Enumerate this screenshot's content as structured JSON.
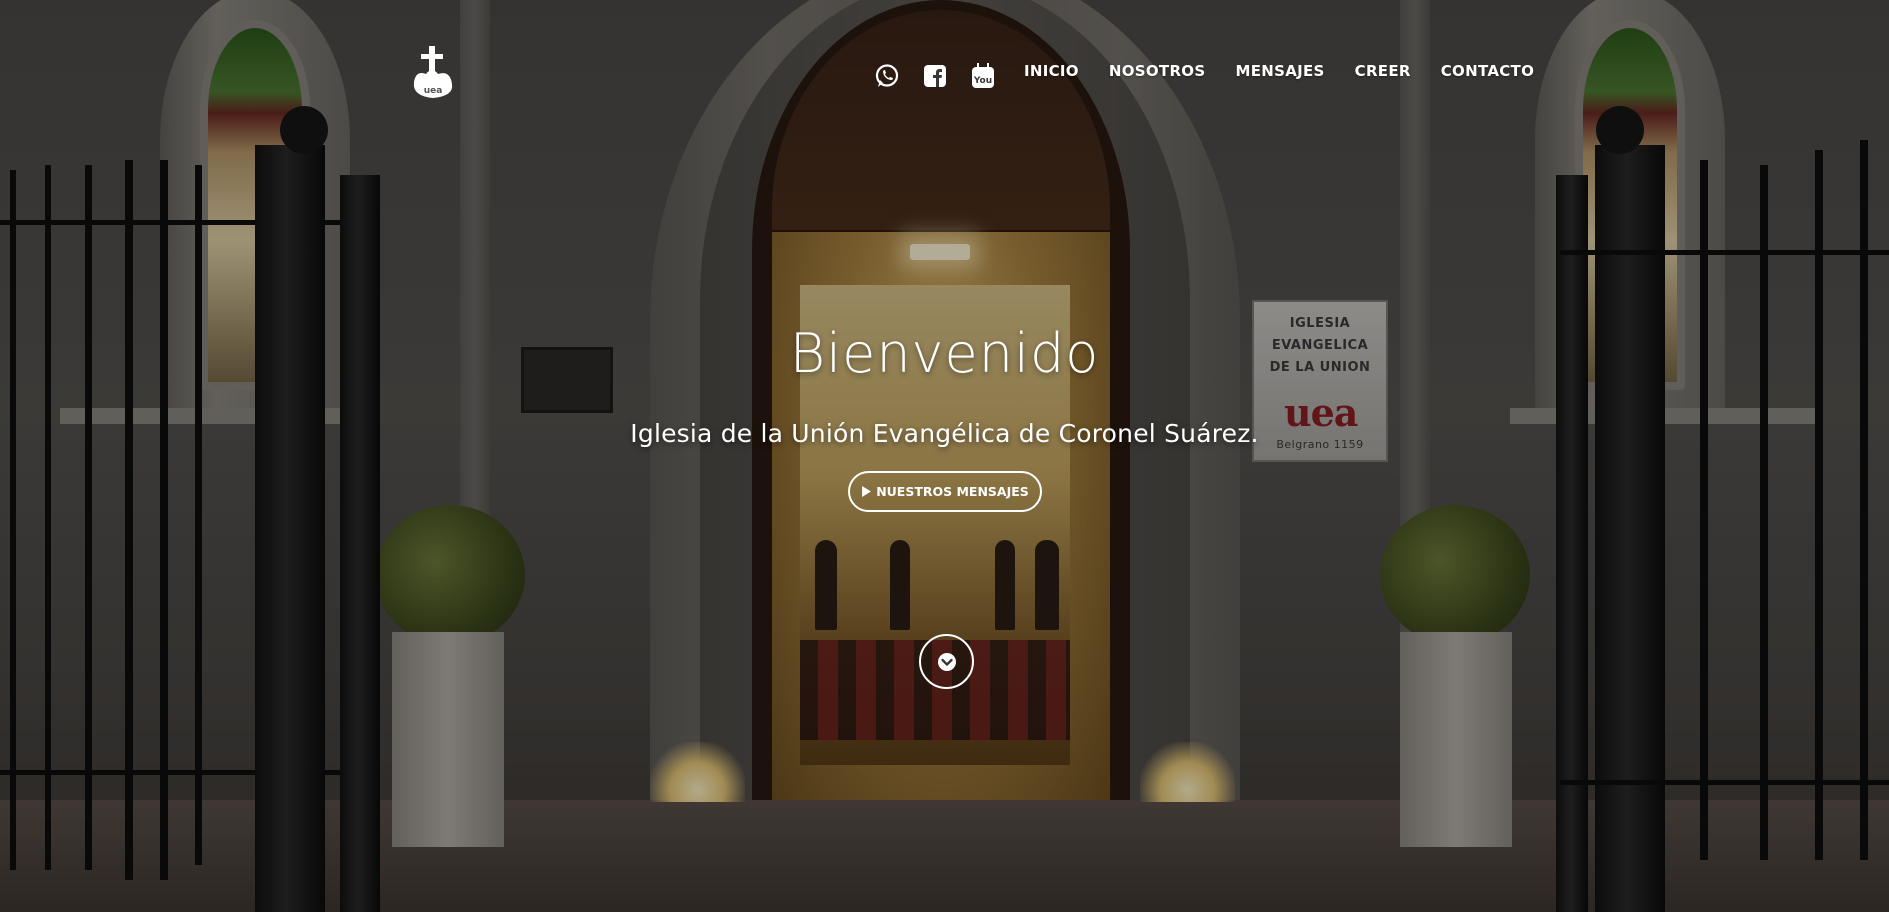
{
  "header": {
    "logo_icon": "cross-uea-logo-icon",
    "social": [
      {
        "icon": "whatsapp-icon"
      },
      {
        "icon": "facebook-icon"
      },
      {
        "icon": "youtube-icon"
      }
    ],
    "nav": [
      {
        "label": "INICIO"
      },
      {
        "label": "NOSOTROS"
      },
      {
        "label": "MENSAJES"
      },
      {
        "label": "CREER"
      },
      {
        "label": "CONTACTO"
      }
    ]
  },
  "hero": {
    "title": "Bienvenido",
    "subtitle": "Iglesia de la Unión Evangélica de Coronel Suárez.",
    "cta_icon": "play-icon",
    "cta_label": "NUESTROS MENSAJES",
    "scroll_icon": "chevron-down-icon"
  },
  "background_sign": {
    "line1": "IGLESIA",
    "line2": "EVANGELICA",
    "line3": "DE LA UNION",
    "logo": "uea",
    "address": "Belgrano 1159"
  },
  "colors": {
    "text": "#ffffff",
    "overlay": "rgba(0,0,0,0.30)",
    "brand_red": "#8b1f24"
  }
}
